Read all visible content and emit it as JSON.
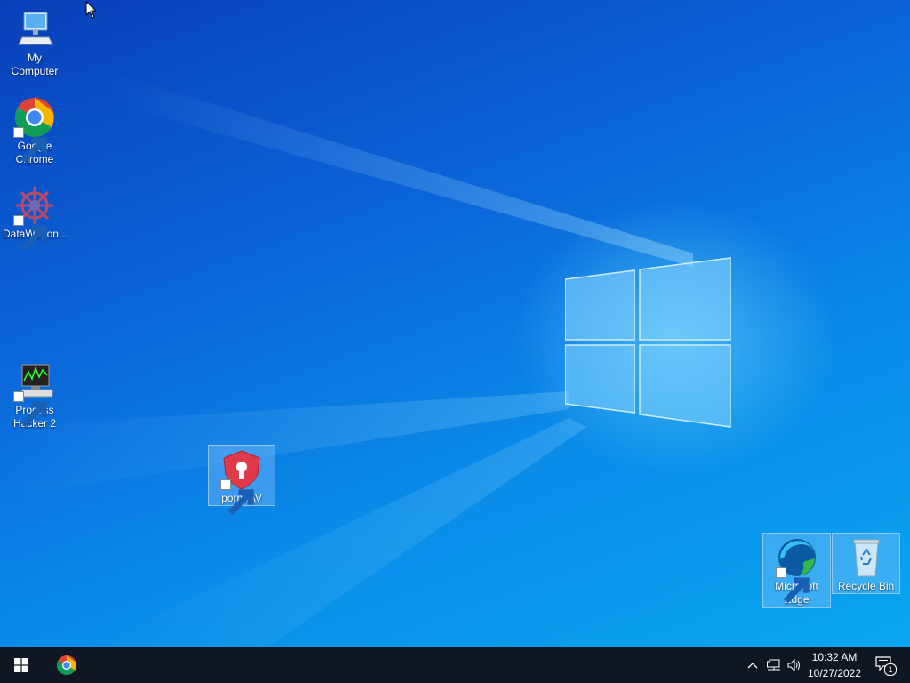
{
  "desktop": {
    "icons": [
      {
        "label": "My Computer",
        "icon": "computer-icon"
      },
      {
        "label": "Google\nChrome",
        "icon": "chrome-icon"
      },
      {
        "label": "DataWagon...",
        "icon": "datawagon-icon"
      },
      {
        "label": "Process\nHacker 2",
        "icon": "process-hacker-icon"
      },
      {
        "label": "pornoAV",
        "icon": "shield-lock-icon"
      },
      {
        "label": "Microsoft\nEdge",
        "icon": "edge-icon"
      },
      {
        "label": "Recycle Bin",
        "icon": "recycle-bin-icon"
      }
    ]
  },
  "taskbar": {
    "start_icon": "windows-start-icon",
    "pinned": [
      "chrome-icon"
    ],
    "tray": {
      "time": "10:32 AM",
      "date": "10/27/2022",
      "notification_count": "1"
    }
  },
  "colors": {
    "taskbar": "#101724",
    "wallpaper_dark": "#0a3fb8",
    "wallpaper_light": "#0aa6f0"
  }
}
